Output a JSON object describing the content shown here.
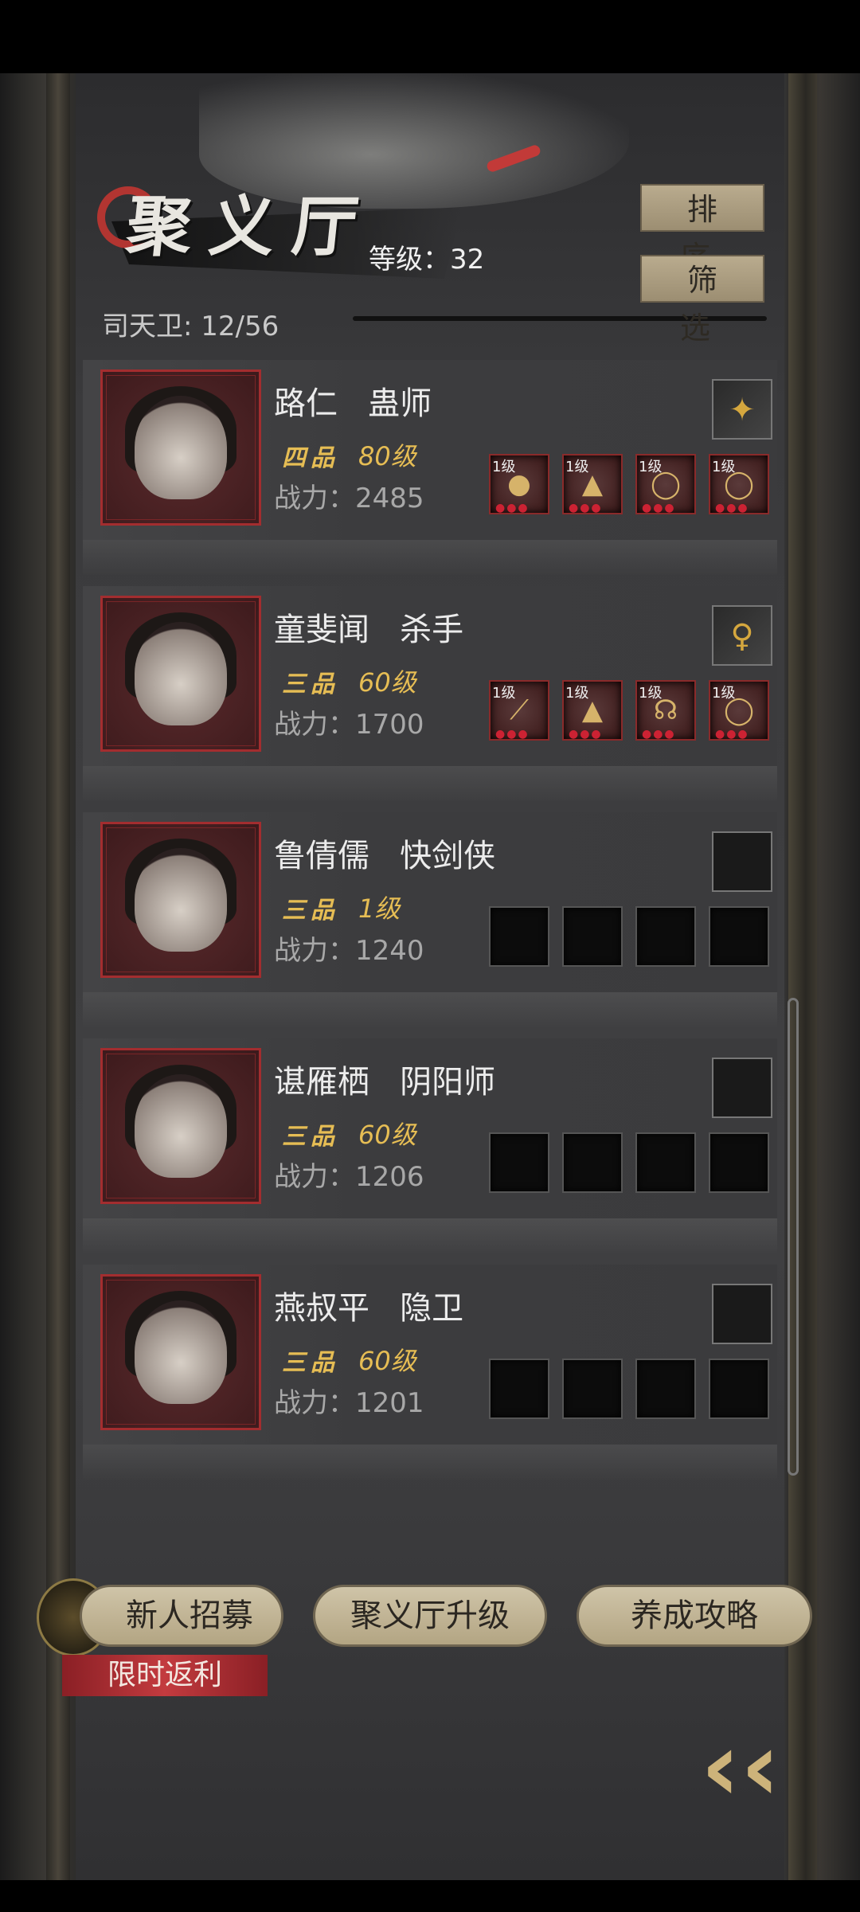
{
  "header": {
    "title": "聚义厅",
    "level_text": "等级：32",
    "members_text": "司天卫: 12/56",
    "sort_label": "排 序",
    "filter_label": "筛 选"
  },
  "roster": [
    {
      "name": "路仁",
      "role": "蛊师",
      "grade": "四品",
      "level": "80级",
      "power": "战力：2485",
      "gear": [
        {
          "tag": "1级",
          "icon": "gourd-icon",
          "glyph": "●"
        },
        {
          "tag": "1级",
          "icon": "armor-icon",
          "glyph": "▲"
        },
        {
          "tag": "1级",
          "icon": "ring-icon",
          "glyph": "◯"
        },
        {
          "tag": "1级",
          "icon": "ring-icon",
          "glyph": "◯"
        }
      ],
      "weapon": {
        "icon": "staff-icon",
        "glyph": "✦",
        "equipped": true
      }
    },
    {
      "name": "童斐闻",
      "role": "杀手",
      "grade": "三品",
      "level": "60级",
      "power": "战力：1700",
      "gear": [
        {
          "tag": "1级",
          "icon": "dagger-icon",
          "glyph": "⟋"
        },
        {
          "tag": "1级",
          "icon": "armor-icon",
          "glyph": "▲"
        },
        {
          "tag": "1级",
          "icon": "amulet-icon",
          "glyph": "☊"
        },
        {
          "tag": "1级",
          "icon": "ring-icon",
          "glyph": "◯"
        }
      ],
      "weapon": {
        "icon": "ladle-icon",
        "glyph": "♀",
        "equipped": true
      }
    },
    {
      "name": "鲁倩儒",
      "role": "快剑侠",
      "grade": "三品",
      "level": "1级",
      "power": "战力：1240",
      "gear": [],
      "weapon": {
        "icon": "empty-slot-icon",
        "glyph": "",
        "equipped": false
      }
    },
    {
      "name": "谌雁栖",
      "role": "阴阳师",
      "grade": "三品",
      "level": "60级",
      "power": "战力：1206",
      "gear": [],
      "weapon": {
        "icon": "empty-slot-icon",
        "glyph": "",
        "equipped": false
      }
    },
    {
      "name": "燕叔平",
      "role": "隐卫",
      "grade": "三品",
      "level": "60级",
      "power": "战力：1201",
      "gear": [],
      "weapon": {
        "icon": "empty-slot-icon",
        "glyph": "",
        "equipped": false
      }
    }
  ],
  "footer": {
    "recruit_label": "新人招募",
    "upgrade_label": "聚义厅升级",
    "guide_label": "养成攻略",
    "promo_badge": "限时返利",
    "back_icon": "double-chevron-left-icon"
  }
}
